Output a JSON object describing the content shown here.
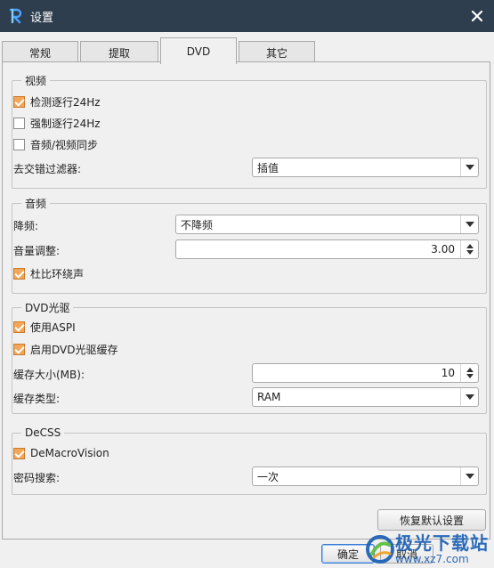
{
  "window": {
    "title": "设置"
  },
  "tabs": [
    {
      "label": "常规"
    },
    {
      "label": "提取"
    },
    {
      "label": "DVD"
    },
    {
      "label": "其它"
    }
  ],
  "video": {
    "legend": "视频",
    "detect_24hz": {
      "label": "检测逐行24Hz",
      "checked": true
    },
    "force_24hz": {
      "label": "强制逐行24Hz",
      "checked": false
    },
    "av_sync": {
      "label": "音频/视频同步",
      "checked": false
    },
    "deinterlace_label": "去交错过滤器:",
    "deinterlace_value": "插值"
  },
  "audio": {
    "legend": "音频",
    "downmix_label": "降频:",
    "downmix_value": "不降频",
    "volume_label": "音量调整:",
    "volume_value": "3.00",
    "dolby": {
      "label": "杜比环绕声",
      "checked": true
    }
  },
  "dvd_drive": {
    "legend": "DVD光驱",
    "use_aspi": {
      "label": "使用ASPI",
      "checked": true
    },
    "enable_cache": {
      "label": "启用DVD光驱缓存",
      "checked": true
    },
    "cache_size_label": "缓存大小(MB):",
    "cache_size_value": "10",
    "cache_type_label": "缓存类型:",
    "cache_type_value": "RAM"
  },
  "decss": {
    "legend": "DeCSS",
    "demacrovision": {
      "label": "DeMacroVision",
      "checked": true
    },
    "key_search_label": "密码搜索:",
    "key_search_value": "一次"
  },
  "buttons": {
    "restore_defaults": "恢复默认设置",
    "ok": "确定",
    "cancel": "取消"
  },
  "watermark": {
    "name": "极光下载站",
    "url": "www.xz7.com"
  },
  "colors": {
    "titlebar": "#2f3e4f",
    "checkbox_checked": "#f2a65a",
    "watermark": "#1a5fb4"
  }
}
